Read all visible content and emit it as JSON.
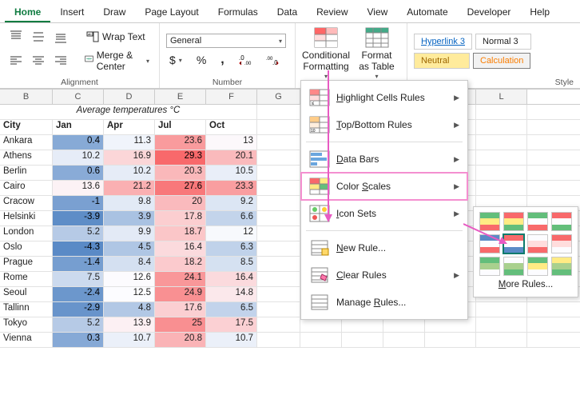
{
  "tabs": [
    "Home",
    "Insert",
    "Draw",
    "Page Layout",
    "Formulas",
    "Data",
    "Review",
    "View",
    "Automate",
    "Developer",
    "Help"
  ],
  "active_tab": 0,
  "ribbon": {
    "wrap": "Wrap Text",
    "merge": "Merge & Center",
    "group_align": "Alignment",
    "numfmt": "General",
    "group_number": "Number",
    "cond_fmt": "Conditional Formatting",
    "fmt_table": "Format as Table",
    "style_hyperlink": "Hyperlink 3",
    "style_normal": "Normal 3",
    "style_neutral": "Neutral",
    "style_calc": "Calculation",
    "group_style": "Style"
  },
  "cf_menu": {
    "hcr": "Highlight Cells Rules",
    "tbr": "Top/Bottom Rules",
    "db": "Data Bars",
    "cs": "Color Scales",
    "is": "Icon Sets",
    "new": "New Rule...",
    "clear": "Clear Rules",
    "manage": "Manage Rules..."
  },
  "cs_more": "More Rules...",
  "sheet": {
    "title": "Average temperatures °C",
    "city_hdr": "City",
    "months": [
      "Jan",
      "Apr",
      "Jul",
      "Oct"
    ],
    "rows": [
      {
        "city": "Ankara",
        "v": [
          0.4,
          11.3,
          23.6,
          13
        ]
      },
      {
        "city": "Athens",
        "v": [
          10.2,
          16.9,
          29.3,
          20.1
        ]
      },
      {
        "city": "Berlin",
        "v": [
          0.6,
          10.2,
          20.3,
          10.5
        ]
      },
      {
        "city": "Cairo",
        "v": [
          13.6,
          21.2,
          27.6,
          23.3
        ]
      },
      {
        "city": "Cracow",
        "v": [
          -1,
          9.8,
          20,
          9.2
        ]
      },
      {
        "city": "Helsinki",
        "v": [
          -3.9,
          3.9,
          17.8,
          6.6
        ]
      },
      {
        "city": "London",
        "v": [
          5.2,
          9.9,
          18.7,
          12
        ]
      },
      {
        "city": "Oslo",
        "v": [
          -4.3,
          4.5,
          16.4,
          6.3
        ]
      },
      {
        "city": "Prague",
        "v": [
          -1.4,
          8.4,
          18.2,
          8.5
        ]
      },
      {
        "city": "Rome",
        "v": [
          7.5,
          12.6,
          24.1,
          16.4
        ]
      },
      {
        "city": "Seoul",
        "v": [
          -2.4,
          12.5,
          24.9,
          14.8
        ]
      },
      {
        "city": "Tallinn",
        "v": [
          -2.9,
          4.8,
          17.6,
          6.5
        ]
      },
      {
        "city": "Tokyo",
        "v": [
          5.2,
          13.9,
          25,
          17.5
        ]
      },
      {
        "city": "Vienna",
        "v": [
          0.3,
          10.7,
          20.8,
          10.7
        ]
      }
    ]
  },
  "chart_data": {
    "type": "table",
    "title": "Average temperatures °C",
    "columns": [
      "City",
      "Jan",
      "Apr",
      "Jul",
      "Oct"
    ],
    "data": [
      [
        "Ankara",
        0.4,
        11.3,
        23.6,
        13
      ],
      [
        "Athens",
        10.2,
        16.9,
        29.3,
        20.1
      ],
      [
        "Berlin",
        0.6,
        10.2,
        20.3,
        10.5
      ],
      [
        "Cairo",
        13.6,
        21.2,
        27.6,
        23.3
      ],
      [
        "Cracow",
        -1,
        9.8,
        20,
        9.2
      ],
      [
        "Helsinki",
        -3.9,
        3.9,
        17.8,
        6.6
      ],
      [
        "London",
        5.2,
        9.9,
        18.7,
        12
      ],
      [
        "Oslo",
        -4.3,
        4.5,
        16.4,
        6.3
      ],
      [
        "Prague",
        -1.4,
        8.4,
        18.2,
        8.5
      ],
      [
        "Rome",
        7.5,
        12.6,
        24.1,
        16.4
      ],
      [
        "Seoul",
        -2.4,
        12.5,
        24.9,
        14.8
      ],
      [
        "Tallinn",
        -2.9,
        4.8,
        17.6,
        6.5
      ],
      [
        "Tokyo",
        5.2,
        13.9,
        25,
        17.5
      ],
      [
        "Vienna",
        0.3,
        10.7,
        20.8,
        10.7
      ]
    ],
    "color_scale": {
      "min": -4.3,
      "max": 29.3,
      "low_color": "#5a8ac6",
      "mid_color": "#fcfcff",
      "high_color": "#f8696b"
    }
  }
}
